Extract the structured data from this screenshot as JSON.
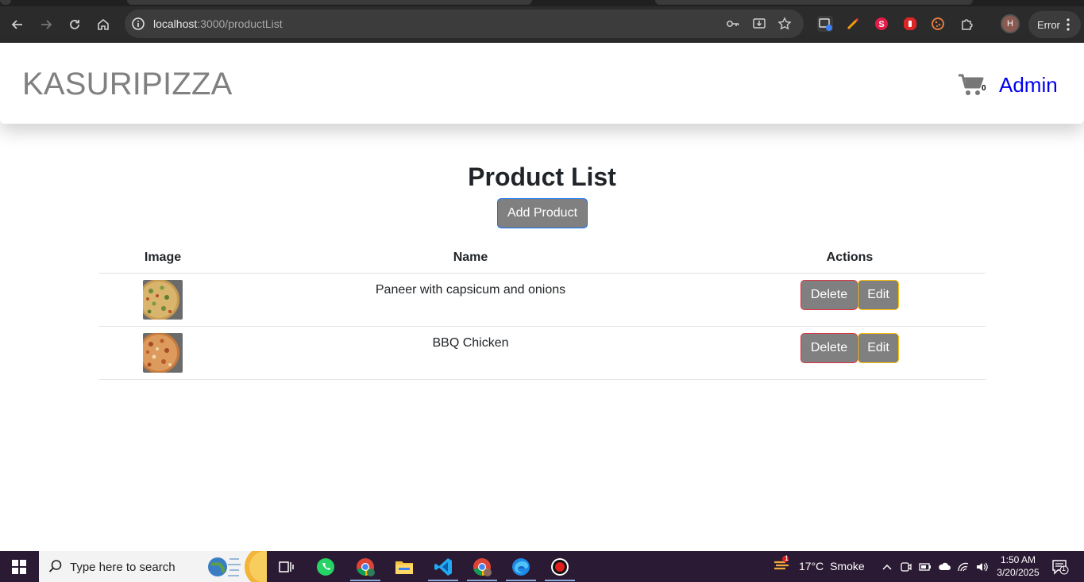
{
  "browser": {
    "url_host": "localhost",
    "url_path": ":3000/productList",
    "profile_initial": "H",
    "error_label": "Error"
  },
  "navbar": {
    "brand": "KASURIPIZZA",
    "cart_count": "0",
    "admin_label": "Admin"
  },
  "main": {
    "title": "Product List",
    "add_button": "Add Product",
    "table": {
      "headers": {
        "image": "Image",
        "name": "Name",
        "actions": "Actions"
      },
      "rows": [
        {
          "name": "Paneer with capsicum and onions",
          "delete_label": "Delete",
          "edit_label": "Edit"
        },
        {
          "name": "BBQ Chicken",
          "delete_label": "Delete",
          "edit_label": "Edit"
        }
      ]
    }
  },
  "taskbar": {
    "search_placeholder": "Type here to search",
    "weather_temp": "17°C",
    "weather_desc": "Smoke",
    "weather_badge": "1",
    "time": "1:50 AM",
    "date": "3/20/2025",
    "notification_count": "1"
  },
  "colors": {
    "button_gray": "#808080",
    "admin_link": "#0000ee",
    "delete_border": "#dc3545",
    "edit_border": "#ffc107",
    "add_border": "#0d6efd"
  }
}
